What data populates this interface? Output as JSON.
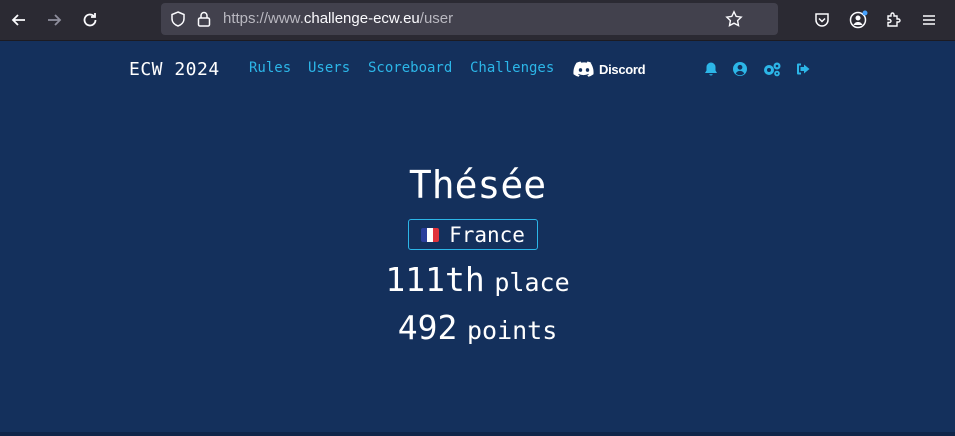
{
  "browser": {
    "url_prefix": "https://www.",
    "url_domain": "challenge-ecw.eu",
    "url_path": "/user"
  },
  "nav": {
    "brand": "ECW 2024",
    "links": [
      "Rules",
      "Users",
      "Scoreboard",
      "Challenges"
    ],
    "discord_label": "Discord",
    "accent": "#2cb6e8"
  },
  "profile": {
    "username": "Thésée",
    "country": "France",
    "rank_value": "111th",
    "rank_label": "place",
    "points_value": "492",
    "points_label": "points"
  },
  "colors": {
    "background": "#14305c",
    "text": "#ffffff",
    "flag": [
      "#2a3f9c",
      "#ffffff",
      "#e0333c"
    ]
  }
}
